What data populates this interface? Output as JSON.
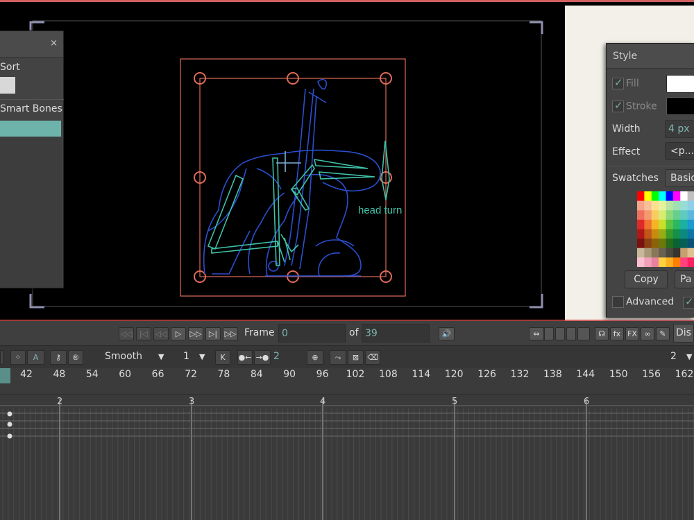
{
  "left_panel": {
    "close": "×",
    "sort_label": "Sort",
    "smart_bones_label": "Smart Bones"
  },
  "canvas": {
    "bone_label": "head turn"
  },
  "style_panel": {
    "title": "Style",
    "fill_label": "Fill",
    "stroke_label": "Stroke",
    "width_label": "Width",
    "width_value": "4 px",
    "effect_label": "Effect",
    "effect_value": "<p...",
    "swatches_label": "Swatches",
    "swatches_value": "Basic",
    "copy_label": "Copy",
    "paste_label": "Pa",
    "advanced_label": "Advanced",
    "fill_color": "#ffffff",
    "stroke_color": "#000000"
  },
  "transport": {
    "frame_label": "Frame",
    "frame_value": "0",
    "of_label": "of",
    "of_value": "39",
    "display_label": "Dis",
    "buttons": [
      "first-frame",
      "prev-key",
      "prev-frame",
      "play",
      "next-frame",
      "next-key",
      "last-frame"
    ]
  },
  "toolbar2": {
    "interpolation": "Smooth",
    "interp_value": "1",
    "keys_value": "2",
    "right_value": "2"
  },
  "ruler": {
    "frames": [
      "42",
      "48",
      "54",
      "60",
      "66",
      "72",
      "78",
      "84",
      "90",
      "96",
      "102",
      "108",
      "114",
      "120",
      "126",
      "132",
      "138",
      "144",
      "150",
      "156",
      "162"
    ],
    "seconds": [
      "2",
      "3",
      "4",
      "5",
      "6"
    ]
  },
  "colors": {
    "accent": "#6eb3ab",
    "canvas_bg": "#000000",
    "bounds": "#e06a5a",
    "rig": "#2a4fd0",
    "bones": "#3fc2a8"
  }
}
